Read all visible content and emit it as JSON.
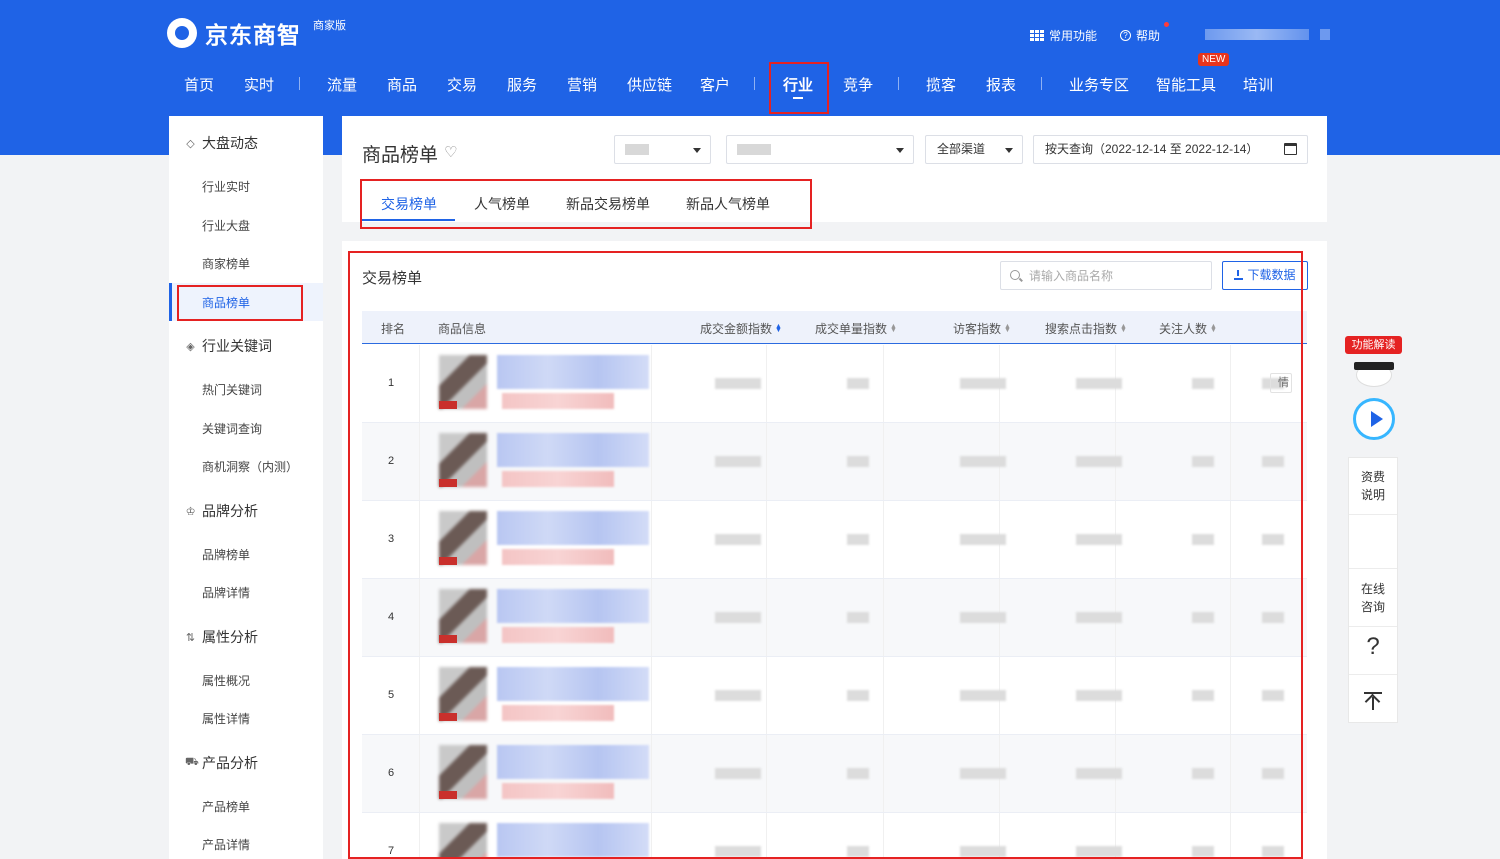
{
  "brand": {
    "name": "京东商智",
    "edition": "商家版"
  },
  "util": {
    "common_functions": "常用功能",
    "help": "帮助"
  },
  "nav": {
    "items": [
      "首页",
      "实时",
      "流量",
      "商品",
      "交易",
      "服务",
      "营销",
      "供应链",
      "客户",
      "行业",
      "竞争",
      "揽客",
      "报表",
      "业务专区",
      "智能工具",
      "培训"
    ],
    "active": "行业",
    "new_badge": "NEW"
  },
  "sidebar": {
    "groups": [
      {
        "label": "大盘动态",
        "icon": "market-icon",
        "items": [
          "行业实时",
          "行业大盘",
          "商家榜单",
          "商品榜单"
        ]
      },
      {
        "label": "行业关键词",
        "icon": "keyword-icon",
        "items": [
          "热门关键词",
          "关键词查询",
          "商机洞察（内测）"
        ]
      },
      {
        "label": "品牌分析",
        "icon": "crown-icon",
        "items": [
          "品牌榜单",
          "品牌详情"
        ]
      },
      {
        "label": "属性分析",
        "icon": "sort-icon",
        "items": [
          "属性概况",
          "属性详情"
        ]
      },
      {
        "label": "产品分析",
        "icon": "cart-icon",
        "items": [
          "产品榜单",
          "产品详情"
        ]
      }
    ],
    "active_item": "商品榜单"
  },
  "header_card": {
    "title": "商品榜单",
    "channel": "全部渠道",
    "date_query": "按天查询（2022-12-14 至 2022-12-14）",
    "tabs": [
      "交易榜单",
      "人气榜单",
      "新品交易榜单",
      "新品人气榜单"
    ],
    "active_tab": "交易榜单"
  },
  "table_card": {
    "title": "交易榜单",
    "search_placeholder": "请输入商品名称",
    "download_label": "下载数据",
    "columns": [
      "排名",
      "商品信息",
      "成交金额指数",
      "成交单量指数",
      "访客指数",
      "搜索点击指数",
      "关注人数"
    ],
    "rows": [
      "1",
      "2",
      "3",
      "4",
      "5",
      "6",
      "7"
    ],
    "detail_label": "情"
  },
  "float": {
    "feature_tag": "功能解读",
    "fee": "资费说明",
    "online": "在线咨询",
    "question": "?"
  }
}
